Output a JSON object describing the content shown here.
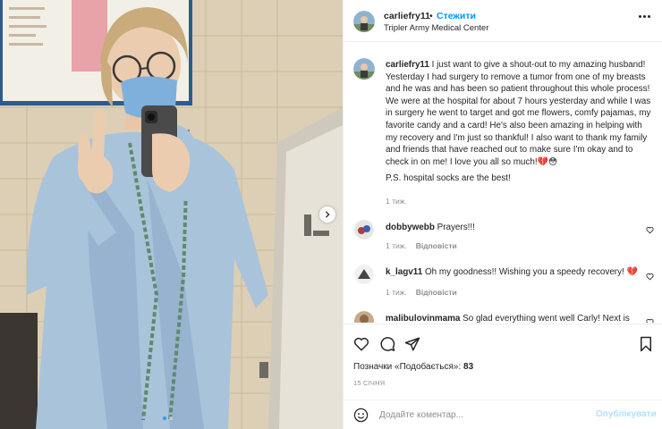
{
  "post": {
    "author": "carliefry11",
    "separator": "•",
    "follow_label": "Стежити",
    "location": "Tripler Army Medical Center",
    "caption": "I just want to give a shout-out to my amazing husband! Yesterday I had surgery to remove a tumor from one of my breasts and he was and has been so patient throughout this whole process! We were at the hospital for about 7 hours yesterday and while I was in surgery he went to target and got me flowers, comfy pajamas, my favorite candy and a card! He's also been amazing in helping with my recovery and I'm just so thankful! I also want to thank my family and friends that have reached out to make sure I'm okay and to check in on me! I love you all so much!💔😳",
    "caption_ps": "P.S. hospital socks are the best!",
    "caption_time": "1 тиж.",
    "media_icons": [
      "more-options-icon",
      "carousel-next-icon"
    ],
    "carousel": {
      "count": 2,
      "active": 1
    }
  },
  "comments": [
    {
      "user": "dobbywebb",
      "text": "Prayers!!!",
      "time": "1 тиж.",
      "reply": "Відповісти"
    },
    {
      "user": "k_lagv11",
      "text": "Oh my goodness!! Wishing you a speedy recovery! 💔",
      "time": "1 тиж.",
      "reply": "Відповісти"
    },
    {
      "user": "malibulovinmama",
      "text": "So glad everything went well Carly! Next is"
    }
  ],
  "actions": {
    "icons": [
      "heart-icon",
      "comment-icon",
      "share-icon",
      "save-icon"
    ],
    "likes_label": "Позначки «Подобається»:",
    "likes_count": "83",
    "date": "15 СІЧНЯ"
  },
  "add_comment": {
    "placeholder": "Додайте коментар...",
    "post_label": "Опублікувати",
    "icon": "emoji-icon"
  },
  "colors": {
    "accent": "#0095f6",
    "post_disabled": "#b2dffc",
    "muted": "#8e8e8e",
    "text": "#262626"
  }
}
